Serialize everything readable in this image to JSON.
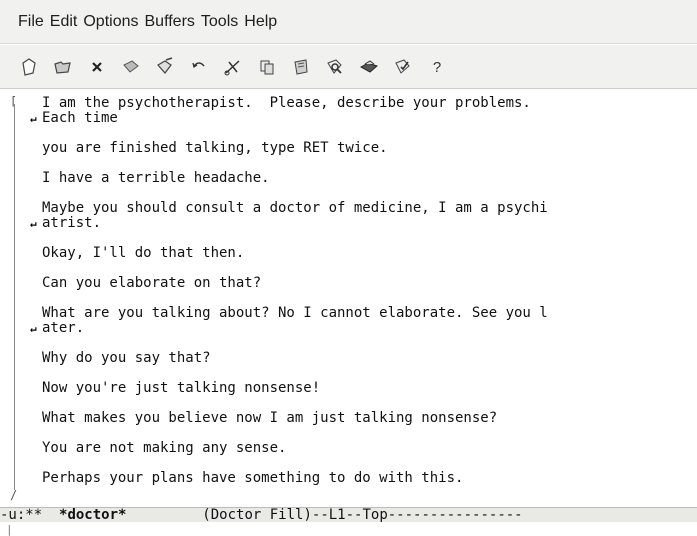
{
  "menubar": {
    "items": [
      "File",
      "Edit",
      "Options",
      "Buffers",
      "Tools",
      "Help"
    ]
  },
  "toolbar": {
    "icons": [
      "new-file-icon",
      "open-folder-icon",
      "close-icon",
      "save-icon",
      "save-as-icon",
      "undo-icon",
      "cut-icon",
      "copy-icon",
      "paste-icon",
      "search-icon",
      "print-icon",
      "preferences-icon",
      "help-icon"
    ],
    "help_glyph": "?"
  },
  "buffer": {
    "paragraphs": [
      {
        "lines": [
          "I am the psychotherapist.  Please, describe your problems.",
          "Each time"
        ],
        "wrapped_line": 1
      },
      {
        "lines": [
          "you are finished talking, type RET twice."
        ]
      },
      {
        "lines": [
          "I have a terrible headache."
        ]
      },
      {
        "lines": [
          "Maybe you should consult a doctor of medicine, I am a psychi",
          "atrist."
        ],
        "wrapped_line": 1
      },
      {
        "lines": [
          "Okay, I'll do that then."
        ]
      },
      {
        "lines": [
          "Can you elaborate on that?"
        ]
      },
      {
        "lines": [
          "What are you talking about? No I cannot elaborate. See you l",
          "ater."
        ],
        "wrapped_line": 1
      },
      {
        "lines": [
          "Why do you say that?"
        ]
      },
      {
        "lines": [
          "Now you're just talking nonsense!"
        ]
      },
      {
        "lines": [
          "What makes you believe now I am just talking nonsense?"
        ]
      },
      {
        "lines": [
          "You are not making any sense."
        ]
      },
      {
        "lines": [
          "Perhaps your plans have something to do with this."
        ]
      }
    ],
    "wrap_marker": "↵"
  },
  "modeline": {
    "prefix": "-u:**  ",
    "buffer_name": "*doctor*",
    "rest": "         (Doctor Fill)--L1--Top----------------"
  }
}
